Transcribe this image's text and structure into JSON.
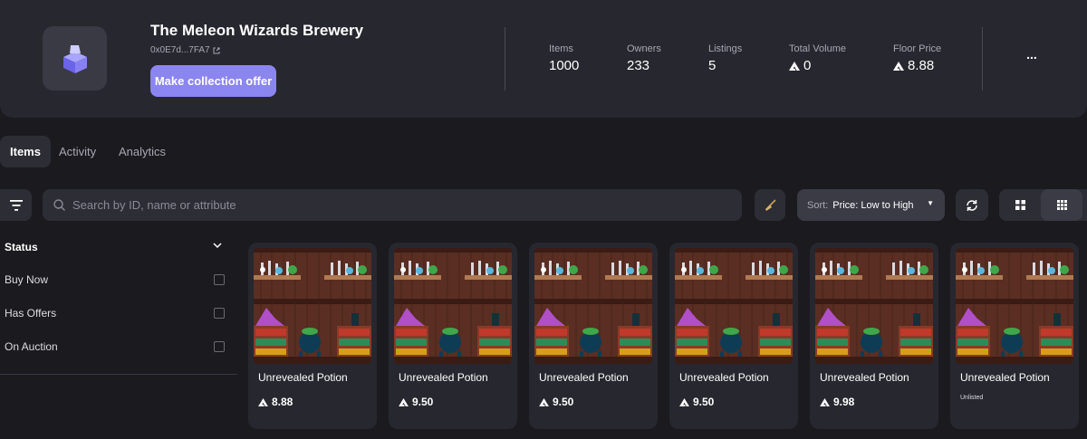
{
  "collection": {
    "title": "The Meleon Wizards Brewery",
    "address": "0x0E7d...7FA7",
    "offer_button": "Make collection offer",
    "stats": [
      {
        "label": "Items",
        "value": "1000",
        "token": false
      },
      {
        "label": "Owners",
        "value": "233",
        "token": false
      },
      {
        "label": "Listings",
        "value": "5",
        "token": false
      },
      {
        "label": "Total Volume",
        "value": "0",
        "token": true
      },
      {
        "label": "Floor Price",
        "value": "8.88",
        "token": true
      }
    ],
    "more_label": "..."
  },
  "tabs": [
    {
      "label": "Items",
      "active": true
    },
    {
      "label": "Activity",
      "active": false
    },
    {
      "label": "Analytics",
      "active": false
    }
  ],
  "search": {
    "placeholder": "Search by ID, name or attribute"
  },
  "sort": {
    "label": "Sort:",
    "value": "Price: Low to High"
  },
  "filters": {
    "status_title": "Status",
    "items": [
      {
        "label": "Buy Now",
        "checked": false
      },
      {
        "label": "Has Offers",
        "checked": false
      },
      {
        "label": "On Auction",
        "checked": false
      }
    ]
  },
  "cards": [
    {
      "name": "Unrevealed Potion",
      "price": "8.88",
      "listed": true
    },
    {
      "name": "Unrevealed Potion",
      "price": "9.50",
      "listed": true
    },
    {
      "name": "Unrevealed Potion",
      "price": "9.50",
      "listed": true
    },
    {
      "name": "Unrevealed Potion",
      "price": "9.50",
      "listed": true
    },
    {
      "name": "Unrevealed Potion",
      "price": "9.98",
      "listed": true
    },
    {
      "name": "Unrevealed Potion",
      "price": "Unlisted",
      "listed": false
    }
  ],
  "colors": {
    "accent": "#8b85f0",
    "background": "#1a1a1f",
    "panel": "#27272f"
  }
}
